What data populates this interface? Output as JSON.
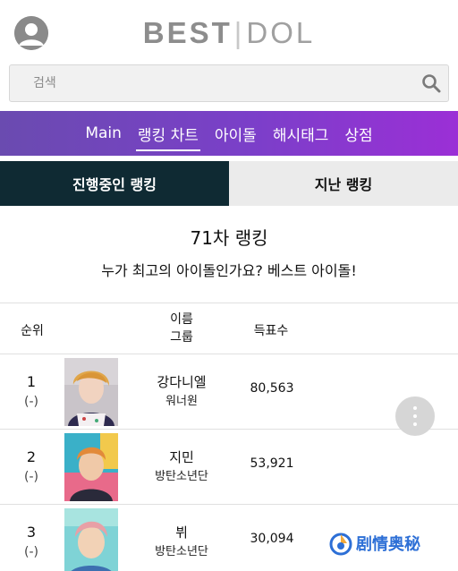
{
  "header": {
    "logo_best": "BEST",
    "logo_sep": "|",
    "logo_idol": "DOL"
  },
  "search": {
    "placeholder": "검색"
  },
  "nav": {
    "items": [
      {
        "label": "Main"
      },
      {
        "label": "랭킹 차트"
      },
      {
        "label": "아이돌"
      },
      {
        "label": "해시태그"
      },
      {
        "label": "상점"
      }
    ],
    "active_index": 1
  },
  "rank_tabs": {
    "current": "진행중인 랭킹",
    "past": "지난 랭킹"
  },
  "round": {
    "title": "71차 랭킹",
    "subtitle": "누가 최고의 아이돌인가요? 베스트 아이돌!"
  },
  "table": {
    "headers": {
      "rank": "순위",
      "name": "이름",
      "group": "그룹",
      "score": "득표수"
    },
    "rows": [
      {
        "rank": "1",
        "change": "(-)",
        "name": "강다니엘",
        "group": "워너원",
        "score": "80,563"
      },
      {
        "rank": "2",
        "change": "(-)",
        "name": "지민",
        "group": "방탄소년단",
        "score": "53,921"
      },
      {
        "rank": "3",
        "change": "(-)",
        "name": "뷔",
        "group": "방탄소년단",
        "score": "30,094"
      }
    ]
  },
  "watermark": {
    "text": "剧情奥秘"
  },
  "colors": {
    "nav_start": "#6a4bb0",
    "nav_end": "#9b2fd6",
    "tab_active_bg": "#0f2a33",
    "tab_inactive_bg": "#ebebeb"
  }
}
